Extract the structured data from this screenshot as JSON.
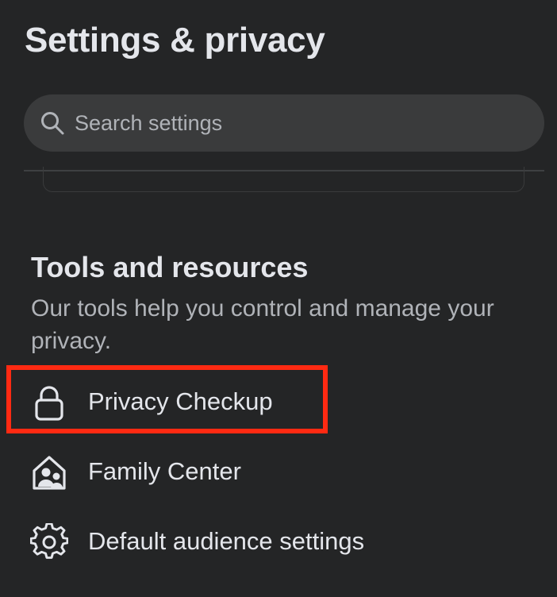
{
  "header": {
    "title": "Settings & privacy"
  },
  "search": {
    "placeholder": "Search settings",
    "icon": "search-icon"
  },
  "tools_section": {
    "title": "Tools and resources",
    "description": "Our tools help you control and manage your privacy.",
    "items": [
      {
        "label": "Privacy Checkup",
        "icon": "lock-icon",
        "highlighted": true
      },
      {
        "label": "Family Center",
        "icon": "family-center-icon",
        "highlighted": false
      },
      {
        "label": "Default audience settings",
        "icon": "gear-icon",
        "highlighted": false
      }
    ]
  },
  "colors": {
    "background": "#242526",
    "search_background": "#3a3b3c",
    "primary_text": "#e4e6eb",
    "secondary_text": "#b0b3b8",
    "highlight": "#ff2a12"
  }
}
